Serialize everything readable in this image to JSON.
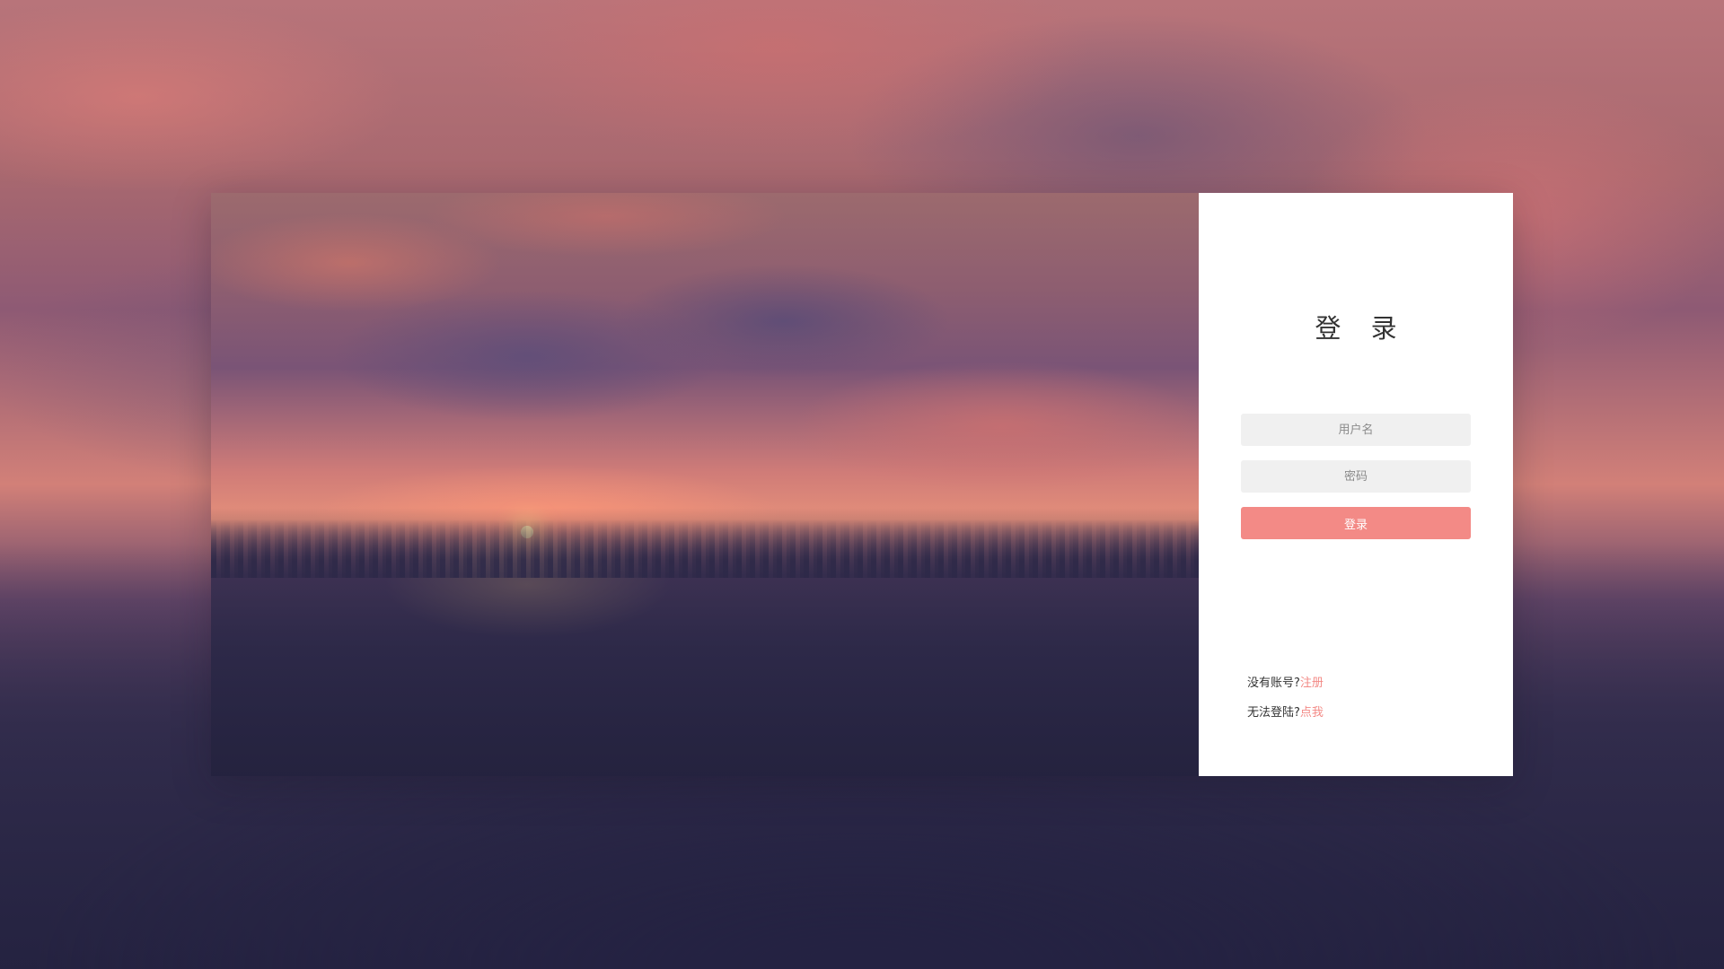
{
  "login": {
    "title": "登 录",
    "username_placeholder": "用户名",
    "password_placeholder": "密码",
    "submit_label": "登录"
  },
  "links": {
    "register_prompt": "没有账号?",
    "register_link": "注册",
    "help_prompt": "无法登陆?",
    "help_link": "点我"
  },
  "colors": {
    "accent": "#f38a86",
    "field_bg": "#f0f0f0",
    "panel_bg": "#ffffff"
  }
}
